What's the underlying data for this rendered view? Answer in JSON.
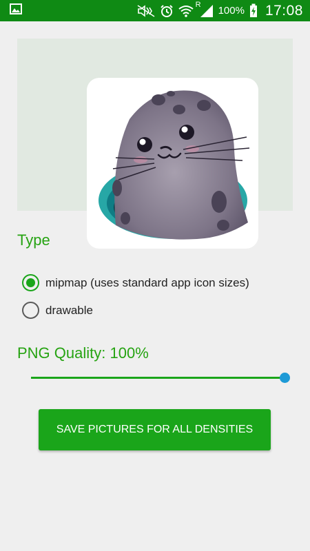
{
  "status_bar": {
    "battery": "100%",
    "time": "17:08",
    "icons": [
      "image-notification-icon",
      "mute-icon",
      "alarm-icon",
      "wifi-icon",
      "signal-icon",
      "battery-charging-icon"
    ],
    "signal_roaming_letter": "R",
    "background_color": "#0f8a14"
  },
  "preview": {
    "image": "seal-app-icon",
    "background_color": "#e1e9e1"
  },
  "type_section": {
    "title": "Type",
    "options": [
      {
        "label": "mipmap (uses standard app icon sizes)",
        "checked": true
      },
      {
        "label": "drawable",
        "checked": false
      }
    ]
  },
  "quality": {
    "label": "PNG Quality: 100%",
    "value_percent": 100
  },
  "actions": {
    "save_label": "SAVE PICTURES FOR ALL DENSITIES"
  },
  "colors": {
    "accent_green": "#1aa51a",
    "label_green": "#26a312",
    "slider_thumb": "#1e9ad6"
  }
}
